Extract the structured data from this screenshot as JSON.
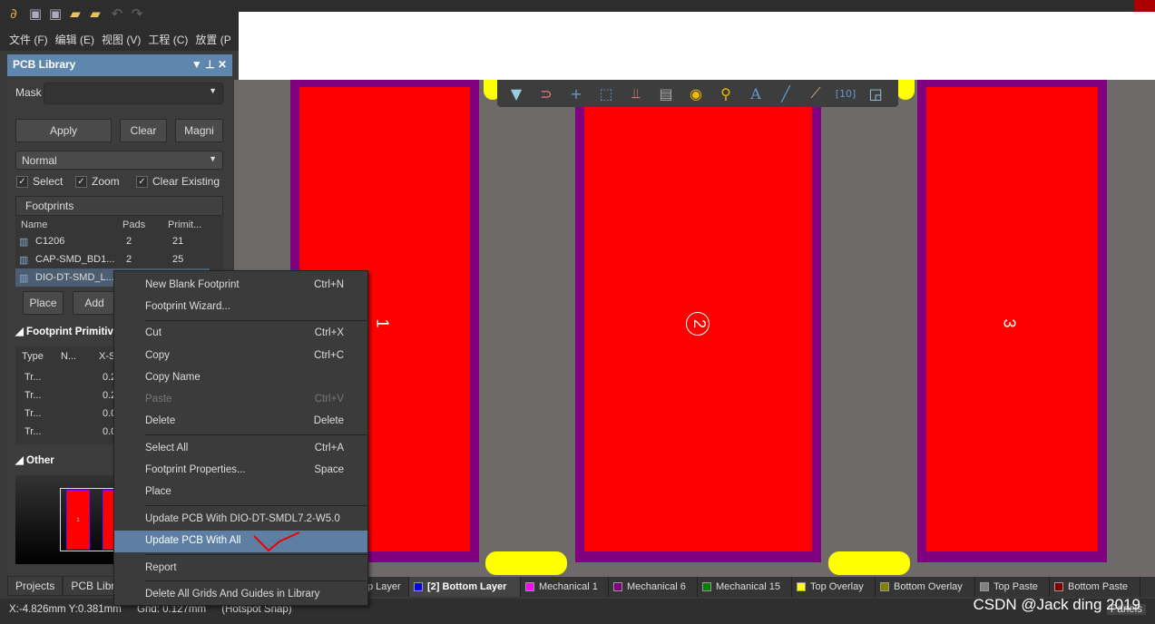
{
  "menu": [
    "文件 (F)",
    "编辑 (E)",
    "视图 (V)",
    "工程 (C)",
    "放置 (P"
  ],
  "panel": {
    "title": "PCB Library",
    "mask_label": "Mask",
    "mask_value": "",
    "apply": "Apply",
    "clear": "Clear",
    "magnify": "Magni",
    "mode": "Normal",
    "checks": [
      {
        "label": "Select",
        "checked": true
      },
      {
        "label": "Zoom",
        "checked": true
      },
      {
        "label": "Clear Existing",
        "checked": true
      }
    ],
    "footprints_header": "Footprints",
    "columns": [
      "Name",
      "Pads",
      "Primit..."
    ],
    "footprints": [
      {
        "name": "C1206",
        "pads": "2",
        "prims": "21"
      },
      {
        "name": "CAP-SMD_BD1...",
        "pads": "2",
        "prims": "25"
      },
      {
        "name": "DIO-DT-SMD_L...",
        "pads": "",
        "prims": ""
      }
    ],
    "place": "Place",
    "add": "Add",
    "primitives_header": "Footprint Primitiv",
    "prim_columns": [
      "Type",
      "N...",
      "X-S"
    ],
    "primitives": [
      {
        "type": "Tr...",
        "x": "0.2"
      },
      {
        "type": "Tr...",
        "x": "0.2"
      },
      {
        "type": "Tr...",
        "x": "0.0"
      },
      {
        "type": "Tr...",
        "x": "0.0"
      }
    ],
    "other_header": "Other",
    "preview_pad": "1"
  },
  "pads": [
    "1",
    "2",
    "3"
  ],
  "context_menu": [
    {
      "label": "New Blank Footprint",
      "shortcut": "Ctrl+N"
    },
    {
      "label": "Footprint Wizard...",
      "shortcut": ""
    },
    {
      "label": "Cut",
      "shortcut": "Ctrl+X"
    },
    {
      "label": "Copy",
      "shortcut": "Ctrl+C"
    },
    {
      "label": "Copy Name",
      "shortcut": ""
    },
    {
      "label": "Paste",
      "shortcut": "Ctrl+V",
      "disabled": true
    },
    {
      "label": "Delete",
      "shortcut": "Delete"
    },
    {
      "label": "Select All",
      "shortcut": "Ctrl+A"
    },
    {
      "label": "Footprint Properties...",
      "shortcut": "Space"
    },
    {
      "label": "Place",
      "shortcut": ""
    },
    {
      "label": "Update PCB With DIO-DT-SMDL7.2-W5.0",
      "shortcut": ""
    },
    {
      "label": "Update PCB With All",
      "shortcut": "",
      "highlighted": true
    },
    {
      "label": "Report",
      "shortcut": ""
    },
    {
      "label": "Delete All Grids And Guides in Library",
      "shortcut": ""
    }
  ],
  "bottom_tabs": [
    "Projects",
    "PCB Librar"
  ],
  "layers": [
    {
      "name": "p Layer",
      "color": "#ff0000"
    },
    {
      "name": "[2] Bottom Layer",
      "color": "#0000ff",
      "active": true
    },
    {
      "name": "Mechanical 1",
      "color": "#ff00ff"
    },
    {
      "name": "Mechanical 6",
      "color": "#800080"
    },
    {
      "name": "Mechanical 15",
      "color": "#008000"
    },
    {
      "name": "Top Overlay",
      "color": "#ffff00"
    },
    {
      "name": "Bottom Overlay",
      "color": "#808000"
    },
    {
      "name": "Top Paste",
      "color": "#808080"
    },
    {
      "name": "Bottom Paste",
      "color": "#800000"
    }
  ],
  "status": {
    "coords": "X:-4.826mm Y:0.381mm",
    "grid": "Grid: 0.127mm",
    "snap": "(Hotspot Snap)",
    "panels": "Panels"
  },
  "watermark": "CSDN @Jack ding 2019"
}
